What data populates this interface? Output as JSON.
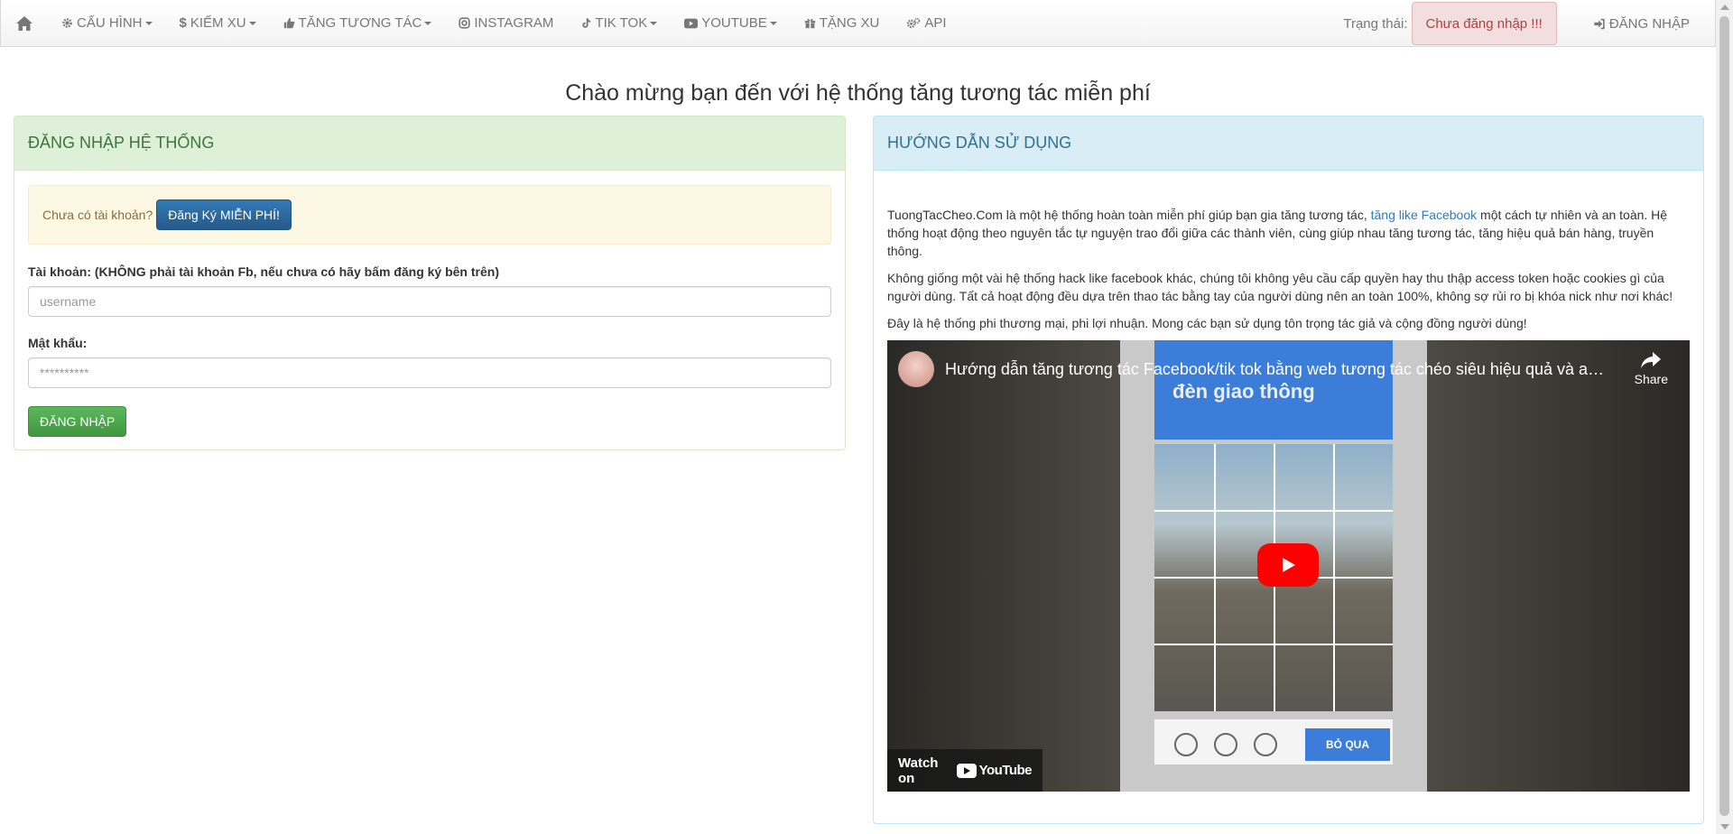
{
  "nav": {
    "items": [
      {
        "label": "CẤU HÌNH",
        "icon": "gear-icon",
        "dropdown": true
      },
      {
        "label": "KIẾM XU",
        "icon": "dollar-icon",
        "dropdown": true
      },
      {
        "label": "TĂNG TƯƠNG TÁC",
        "icon": "thumbs-up-icon",
        "dropdown": true
      },
      {
        "label": "INSTAGRAM",
        "icon": "instagram-icon",
        "dropdown": false
      },
      {
        "label": "TIK TOK",
        "icon": "tiktok-icon",
        "dropdown": true
      },
      {
        "label": "YOUTUBE",
        "icon": "youtube-icon",
        "dropdown": true
      },
      {
        "label": "TẶNG XU",
        "icon": "gift-icon",
        "dropdown": false
      },
      {
        "label": "API",
        "icon": "gears-icon",
        "dropdown": false
      }
    ],
    "status_label": "Trạng thái:",
    "status_value": "Chưa đăng nhập !!!",
    "login_label": "ĐĂNG NHẬP"
  },
  "page_title": "Chào mừng bạn đến với hệ thống tăng tương tác miễn phí",
  "login_panel": {
    "heading": "ĐĂNG NHẬP HỆ THỐNG",
    "alert_text": "Chưa có tài khoản?",
    "register_button": "Đăng Ký MIỄN PHÍ!",
    "username_label": "Tài khoản: (KHÔNG phải tài khoản Fb, nếu chưa có hãy bấm đăng ký bên trên)",
    "username_placeholder": "username",
    "password_label": "Mật khẩu:",
    "password_placeholder": "**********",
    "login_button": "ĐĂNG NHẬP"
  },
  "guide_panel": {
    "heading": "HƯỚNG DẪN SỬ DỤNG",
    "p1_before": "TuongTacCheo.Com là một hệ thống hoàn toàn miễn phí giúp bạn gia tăng tương tác, ",
    "p1_link": "tăng like Facebook",
    "p1_after": " một cách tự nhiên và an toàn. Hệ thống hoạt động theo nguyên tắc tự nguyện trao đổi giữa các thành viên, cùng giúp nhau tăng tương tác, tăng hiệu quả bán hàng, truyền thông.",
    "p2": "Không giống một vài hệ thống hack like facebook khác, chúng tôi không yêu cầu cấp quyền hay thu thập access token hoặc cookies gì của người dùng. Tất cả hoạt động đều dựa trên thao tác bằng tay của người dùng nên an toàn 100%, không sợ rủi ro bị khóa nick như nơi khác!",
    "p3": "Đây là hệ thống phi thương mại, phi lợi nhuận. Mong các bạn sử dụng tôn trọng tác giả và cộng đồng người dùng!"
  },
  "video": {
    "title": "Hướng dẫn tăng tương tác Facebook/tik tok bằng web tương tác chéo siêu hiệu quả và an to...",
    "share_label": "Share",
    "watch_on": "Watch on",
    "youtube_brand": "YouTube",
    "frame_text_top": "đèn giao thông",
    "frame_skip": "BỎ QUA"
  }
}
